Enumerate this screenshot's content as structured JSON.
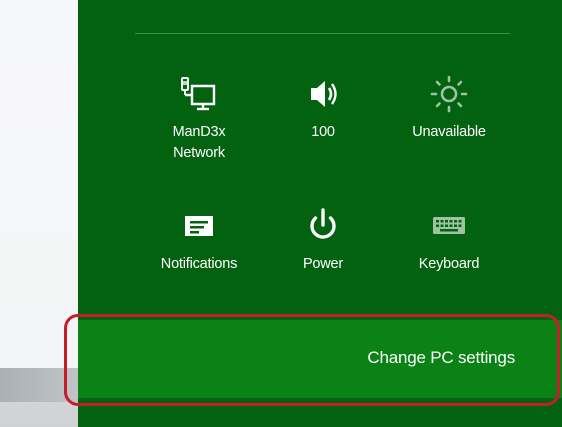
{
  "quick_settings": {
    "network": {
      "label_line1": "ManD3x",
      "label_line2": "Network",
      "icon": "network-icon"
    },
    "volume": {
      "label": "100",
      "icon": "speaker-icon"
    },
    "brightness": {
      "label": "Unavailable",
      "icon": "brightness-icon"
    },
    "notifications": {
      "label": "Notifications",
      "icon": "notifications-icon"
    },
    "power": {
      "label": "Power",
      "icon": "power-icon"
    },
    "keyboard": {
      "label": "Keyboard",
      "icon": "keyboard-icon"
    }
  },
  "change_pc_settings": {
    "label": "Change PC settings"
  },
  "colors": {
    "charm_background": "#03620f",
    "button_background": "#0a8215",
    "highlight_ring": "#c41e2a",
    "disabled_icon": "#9fc2a3"
  }
}
